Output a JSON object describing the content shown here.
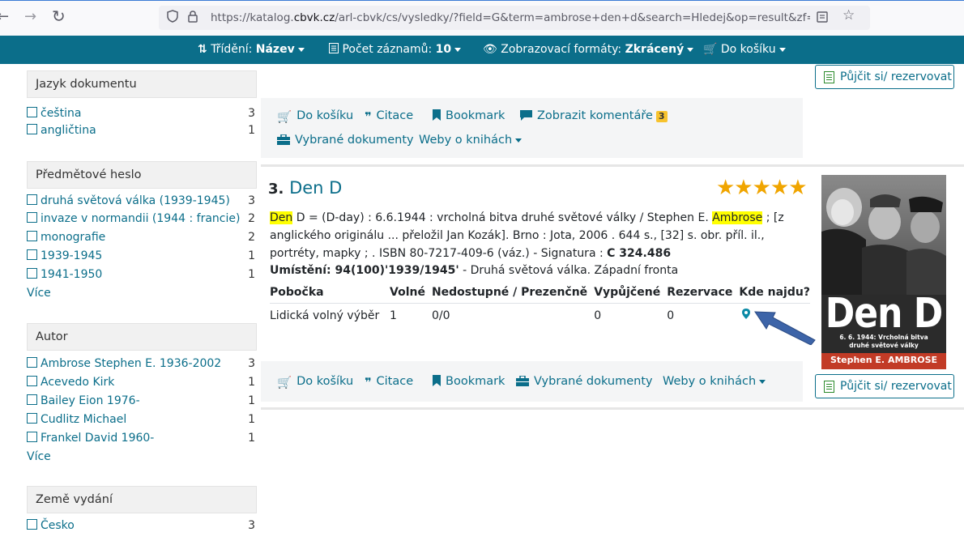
{
  "browser": {
    "url_prefix": "https://katalog.",
    "url_domain": "cbvk.cz",
    "url_rest": "/arl-cbvk/cs/vysledky/?field=G&term=ambrose+den+d&search=Hledej&op=result&zf=&sort=&g"
  },
  "toolbar": {
    "sort_label": "Třídění:",
    "sort_value": "Název",
    "count_label": "Počet záznamů:",
    "count_value": "10",
    "format_label": "Zobrazovací formáty:",
    "format_value": "Zkrácený",
    "cart_label": "Do košíku"
  },
  "sidebar": {
    "language": {
      "title": "Jazyk dokumentu",
      "items": [
        {
          "label": "čeština",
          "count": "3"
        },
        {
          "label": "angličtina",
          "count": "1"
        }
      ]
    },
    "subject": {
      "title": "Předmětové heslo",
      "items": [
        {
          "label": "druhá světová válka (1939-1945)",
          "count": "3"
        },
        {
          "label": "invaze v normandii (1944 : francie)",
          "count": "2"
        },
        {
          "label": "monografie",
          "count": "2"
        },
        {
          "label": "1939-1945",
          "count": "1"
        },
        {
          "label": "1941-1950",
          "count": "1"
        }
      ],
      "more": "Více"
    },
    "author": {
      "title": "Autor",
      "items": [
        {
          "label": "Ambrose Stephen E. 1936-2002",
          "count": "3"
        },
        {
          "label": "Acevedo Kirk",
          "count": "1"
        },
        {
          "label": "Bailey Eion 1976-",
          "count": "1"
        },
        {
          "label": "Cudlitz Michael",
          "count": "1"
        },
        {
          "label": "Frankel David 1960-",
          "count": "1"
        }
      ],
      "more": "Více"
    },
    "country": {
      "title": "Země vydání",
      "items": [
        {
          "label": "Česko",
          "count": "3"
        }
      ]
    }
  },
  "actions": {
    "cart": "Do košíku",
    "cite": "Citace",
    "bookmark": "Bookmark",
    "comments": "Zobrazit komentáře",
    "comments_count": "3",
    "selected_docs": "Vybrané dokumenty",
    "web_books": "Weby o knihách",
    "reserve": "Půjčit si/ rezervovat"
  },
  "record": {
    "number": "3.",
    "title": "Den D",
    "rating": 5,
    "stars": "★★★★★",
    "desc_hl1": "Den",
    "desc_part1": " D = (D-day) : 6.6.1944 : vrcholná bitva druhé světové války / Stephen E. ",
    "desc_hl2": "Ambrose",
    "desc_part2": " ; [z anglického originálu ... přeložil Jan Kozák].    Brno : Jota, 2006 . 644 s., [32] s. obr. příl. il., portréty, mapky ; . ISBN 80-7217-409-6 (váz.) - Signatura : ",
    "signature": "C 324.486",
    "location_label": "Umístění: 94(100)'1939/1945'",
    "location_rest": " - Druhá světová válka. Západní fronta",
    "holdings": {
      "headers": [
        "Pobočka",
        "Volné",
        "Nedostupné / Prezenčně",
        "Vypůjčené",
        "Rezervace",
        "Kde najdu?"
      ],
      "row": [
        "Lidická volný výběr",
        "1",
        "0/0",
        "0",
        "0"
      ]
    },
    "cover": {
      "title": "Den D",
      "subtitle1": "6. 6. 1944: Vrcholná bitva",
      "subtitle2": "druhé světové války",
      "author": "Stephen E. AMBROSE"
    }
  },
  "colors": {
    "accent": "#0b6e8a",
    "highlight": "#ffff00",
    "star": "#f0a500",
    "arrow": "#3d64a8"
  }
}
